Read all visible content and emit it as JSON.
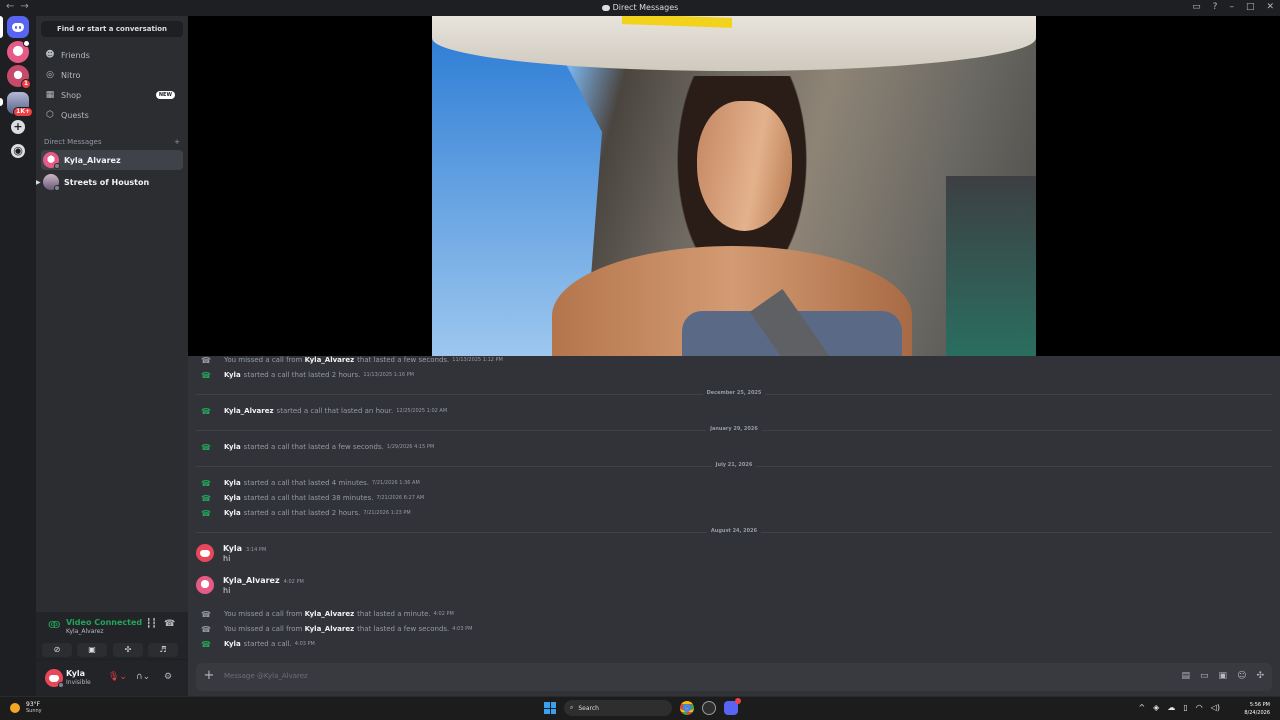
{
  "window": {
    "title": "Direct Messages",
    "nav_back": "←",
    "nav_forward": "→"
  },
  "servers": {
    "badge_b": "1",
    "badge_c": "1K+"
  },
  "sidebar": {
    "search_label": "Find or start a conversation",
    "nav": [
      {
        "label": "Friends",
        "icon": "friends-icon"
      },
      {
        "label": "Nitro",
        "icon": "nitro-icon"
      },
      {
        "label": "Shop",
        "icon": "shop-icon",
        "badge": "NEW"
      },
      {
        "label": "Quests",
        "icon": "quests-icon"
      }
    ],
    "dm_header": "Direct Messages",
    "dm_add": "+",
    "dms": [
      {
        "name": "Kyla_Alvarez"
      },
      {
        "name": "Streets of Houston"
      }
    ]
  },
  "voice": {
    "title": "Video Connected",
    "subtitle": "Kyla_Alvarez"
  },
  "user": {
    "name": "Kyla",
    "status": "Invisible"
  },
  "chat": {
    "call_rows_top": [
      {
        "type": "miss",
        "prefix": "You missed a call from",
        "who": "Kyla_Alvarez",
        "rest": "that lasted a few seconds.",
        "ts": "11/13/2025 1:12 PM"
      },
      {
        "type": "ok",
        "who": "Kyla",
        "rest": "started a call that lasted 2 hours.",
        "ts": "11/13/2025 1:16 PM"
      }
    ],
    "dividers": [
      "December 25, 2025",
      "January 29, 2026",
      "July 21, 2026",
      "August 24, 2026"
    ],
    "call_dec": {
      "type": "ok",
      "who": "Kyla_Alvarez",
      "rest": "started a call that lasted an hour.",
      "ts": "12/25/2025 1:02 AM"
    },
    "call_jan": {
      "type": "ok",
      "who": "Kyla",
      "rest": "started a call that lasted a few seconds.",
      "ts": "1/29/2026 4:15 PM"
    },
    "calls_jul": [
      {
        "type": "ok",
        "who": "Kyla",
        "rest": "started a call that lasted 4 minutes.",
        "ts": "7/21/2026 1:36 AM"
      },
      {
        "type": "ok",
        "who": "Kyla",
        "rest": "started a call that lasted 38 minutes.",
        "ts": "7/21/2026 6:27 AM"
      },
      {
        "type": "ok",
        "who": "Kyla",
        "rest": "started a call that lasted 2 hours.",
        "ts": "7/21/2026 1:23 PM"
      }
    ],
    "messages": [
      {
        "name": "Kyla",
        "ts": "3:14 PM",
        "text": "hi"
      },
      {
        "name": "Kyla_Alvarez",
        "ts": "4:02 PM",
        "text": "hi"
      }
    ],
    "calls_aug": [
      {
        "type": "miss",
        "prefix": "You missed a call from",
        "who": "Kyla_Alvarez",
        "rest": "that lasted a minute.",
        "ts": "4:02 PM"
      },
      {
        "type": "miss",
        "prefix": "You missed a call from",
        "who": "Kyla_Alvarez",
        "rest": "that lasted a few seconds.",
        "ts": "4:03 PM"
      },
      {
        "type": "ok",
        "who": "Kyla",
        "rest": "started a call.",
        "ts": "4:03 PM"
      }
    ],
    "composer_placeholder": "Message @Kyla_Alvarez"
  },
  "taskbar": {
    "temp": "93°F",
    "condition": "Sunny",
    "search": "Search",
    "time": "5:56 PM",
    "date": "8/24/2026"
  }
}
